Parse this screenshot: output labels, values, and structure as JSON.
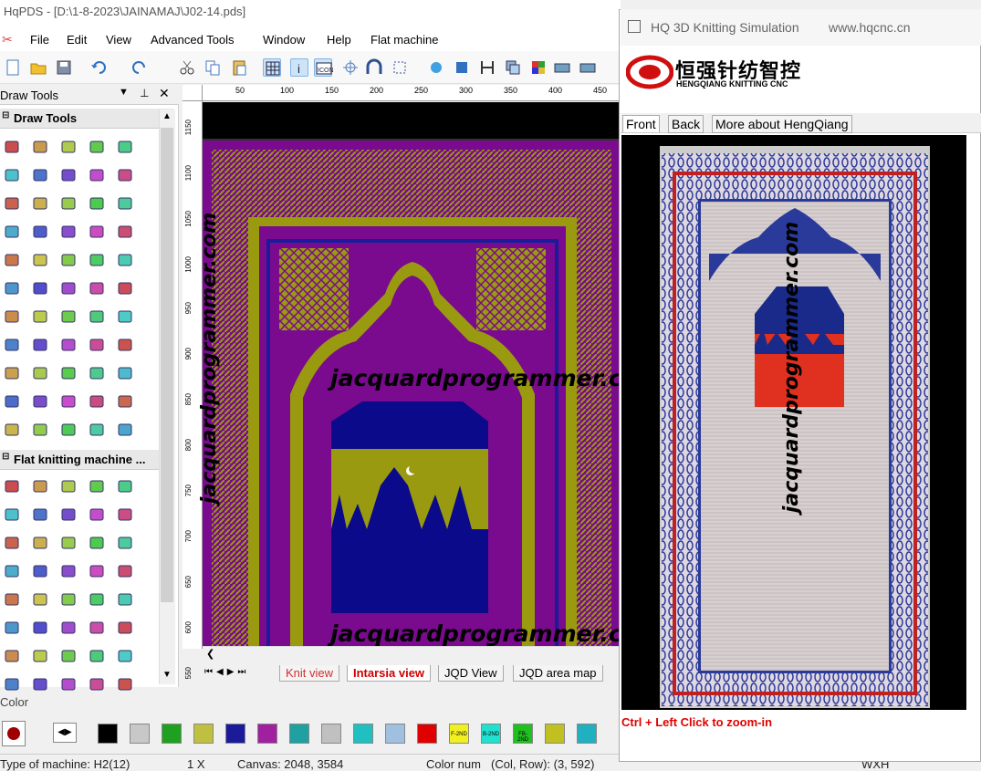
{
  "app": {
    "title": "HqPDS - [D:\\1-8-2023\\JAINAMAJ\\J02-14.pds]",
    "menu": [
      "File",
      "Edit",
      "View",
      "Advanced Tools",
      "Window",
      "Help",
      "Flat machine"
    ]
  },
  "panels": {
    "draw_tools_header": "Draw Tools",
    "draw_tools_group": "Draw Tools",
    "flat_group": "Flat knitting machine ..."
  },
  "ruler": {
    "top_ticks": [
      "50",
      "100",
      "150",
      "200",
      "250",
      "300",
      "350",
      "400",
      "450"
    ],
    "left_ticks": [
      "1150",
      "1100",
      "1050",
      "1000",
      "950",
      "900",
      "850",
      "800",
      "750",
      "700",
      "650",
      "600",
      "550"
    ]
  },
  "view_tabs": [
    "Knit view",
    "Intarsia view",
    "JQD View",
    "JQD area map"
  ],
  "colorbar": {
    "title": "Color",
    "colors": [
      "#000000",
      "#c8c8c8",
      "#20a020",
      "#c0c040",
      "#1a1a9a",
      "#a020a0",
      "#20a0a0",
      "#c0c0c0",
      "#20c0c0",
      "#a0c0e0",
      "#e00000",
      "#f0f020",
      "#20e0d0",
      "#20c020",
      "#c0c020",
      "#20b0c0"
    ],
    "swatch_labels": [
      "",
      "",
      "",
      "",
      "",
      "",
      "",
      "",
      "",
      "",
      "",
      "F-2ND",
      "B-2ND",
      "FB-2ND",
      "",
      ""
    ]
  },
  "status": {
    "machine": "Type of machine: H2(12)",
    "zoom": "1 X",
    "canvas": "Canvas: 2048, 3584",
    "colornum": "Color num",
    "colrow": "(Col, Row): (3, 592)",
    "wxh": "WXH"
  },
  "sim": {
    "title": "HQ 3D Knitting Simulation",
    "url": "www.hqcnc.cn",
    "logo_cn": "恒强针纺智控",
    "logo_en": "HENGQIANG KNITTING CNC",
    "tabs": [
      "Front",
      "Back",
      "More about HengQiang"
    ],
    "hint": "Ctrl + Left Click to zoom-in"
  },
  "watermark": "jacquardprogrammer.com",
  "colors": {
    "purple": "#7a0a8e",
    "olive": "#9a9a10",
    "navy": "#0a0a8a",
    "red": "#d02020"
  }
}
